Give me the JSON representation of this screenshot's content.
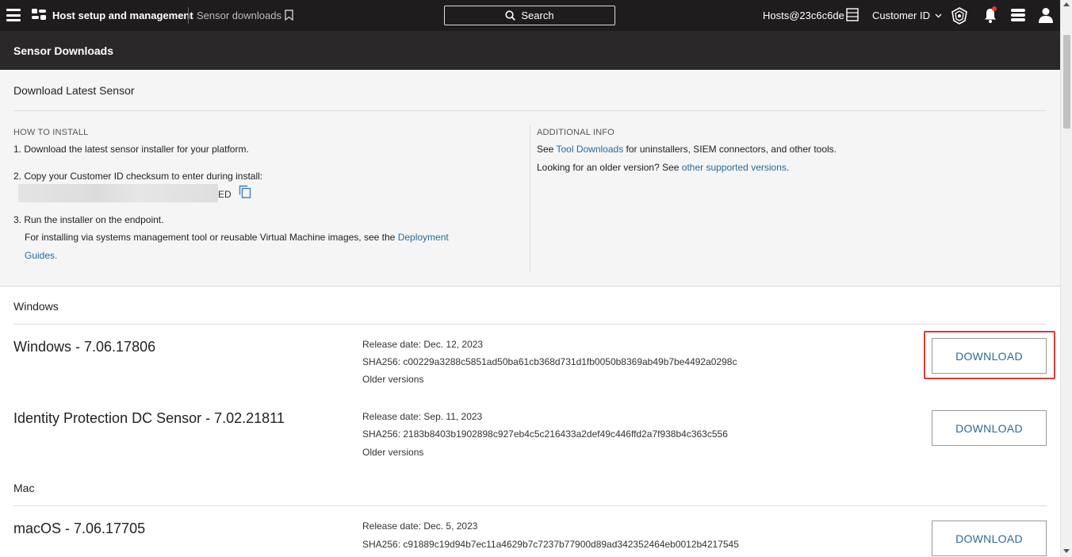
{
  "topbar": {
    "app_title": "Host setup and management",
    "breadcrumb": "Sensor downloads",
    "search_label": "Search",
    "host_label": "Hosts@23c6c6de",
    "customer_dropdown": "Customer ID"
  },
  "header": {
    "title": "Sensor Downloads"
  },
  "latest": {
    "title": "Download Latest Sensor",
    "how_to_install": {
      "label": "HOW TO INSTALL",
      "step1": "1. Download the latest sensor installer for your platform.",
      "step2": "2. Copy your Customer ID checksum to enter during install:",
      "cid_suffix": "ED",
      "step3": "3. Run the installer on the endpoint.",
      "step3_detail_prefix": "For installing via systems management tool or reusable Virtual Machine images, see the",
      "step3_link_line1": "Deployment",
      "step3_link_line2": "Guides",
      "step3_end": "."
    },
    "additional_info": {
      "label": "ADDITIONAL INFO",
      "line1_prefix": "See",
      "line1_link": "Tool Downloads",
      "line1_suffix": "for uninstallers, SIEM connectors, and other tools.",
      "line2_prefix": "Looking for an older version? See",
      "line2_link": "other supported versions",
      "line2_suffix": "."
    }
  },
  "sections": {
    "windows": "Windows",
    "mac": "Mac"
  },
  "products": [
    {
      "name": "Windows - 7.06.17806",
      "release": "Release date: Dec. 12, 2023",
      "sha": "SHA256: c00229a3288c5851ad50ba61cb368d731d1fb0050b8369ab49b7be4492a0298c",
      "older": "Older versions",
      "download": "DOWNLOAD"
    },
    {
      "name": "Identity Protection DC Sensor - 7.02.21811",
      "release": "Release date: Sep. 11, 2023",
      "sha": "SHA256: 2183b8403b1902898c927eb4c5c216433a2def49c446ffd2a7f938b4c363c556",
      "older": "Older versions",
      "download": "DOWNLOAD"
    },
    {
      "name": "macOS - 7.06.17705",
      "release": "Release date: Dec. 5, 2023",
      "sha": "SHA256: c91889c19d94b7ec11a4629b7c7237b77900d89ad342352464eb0012b4217545",
      "download": "DOWNLOAD"
    }
  ],
  "colors": {
    "topbar_bg": "#1f1c1d",
    "header_bg": "#2b2829",
    "link": "#2b6a9b",
    "highlight": "#d9393b"
  }
}
